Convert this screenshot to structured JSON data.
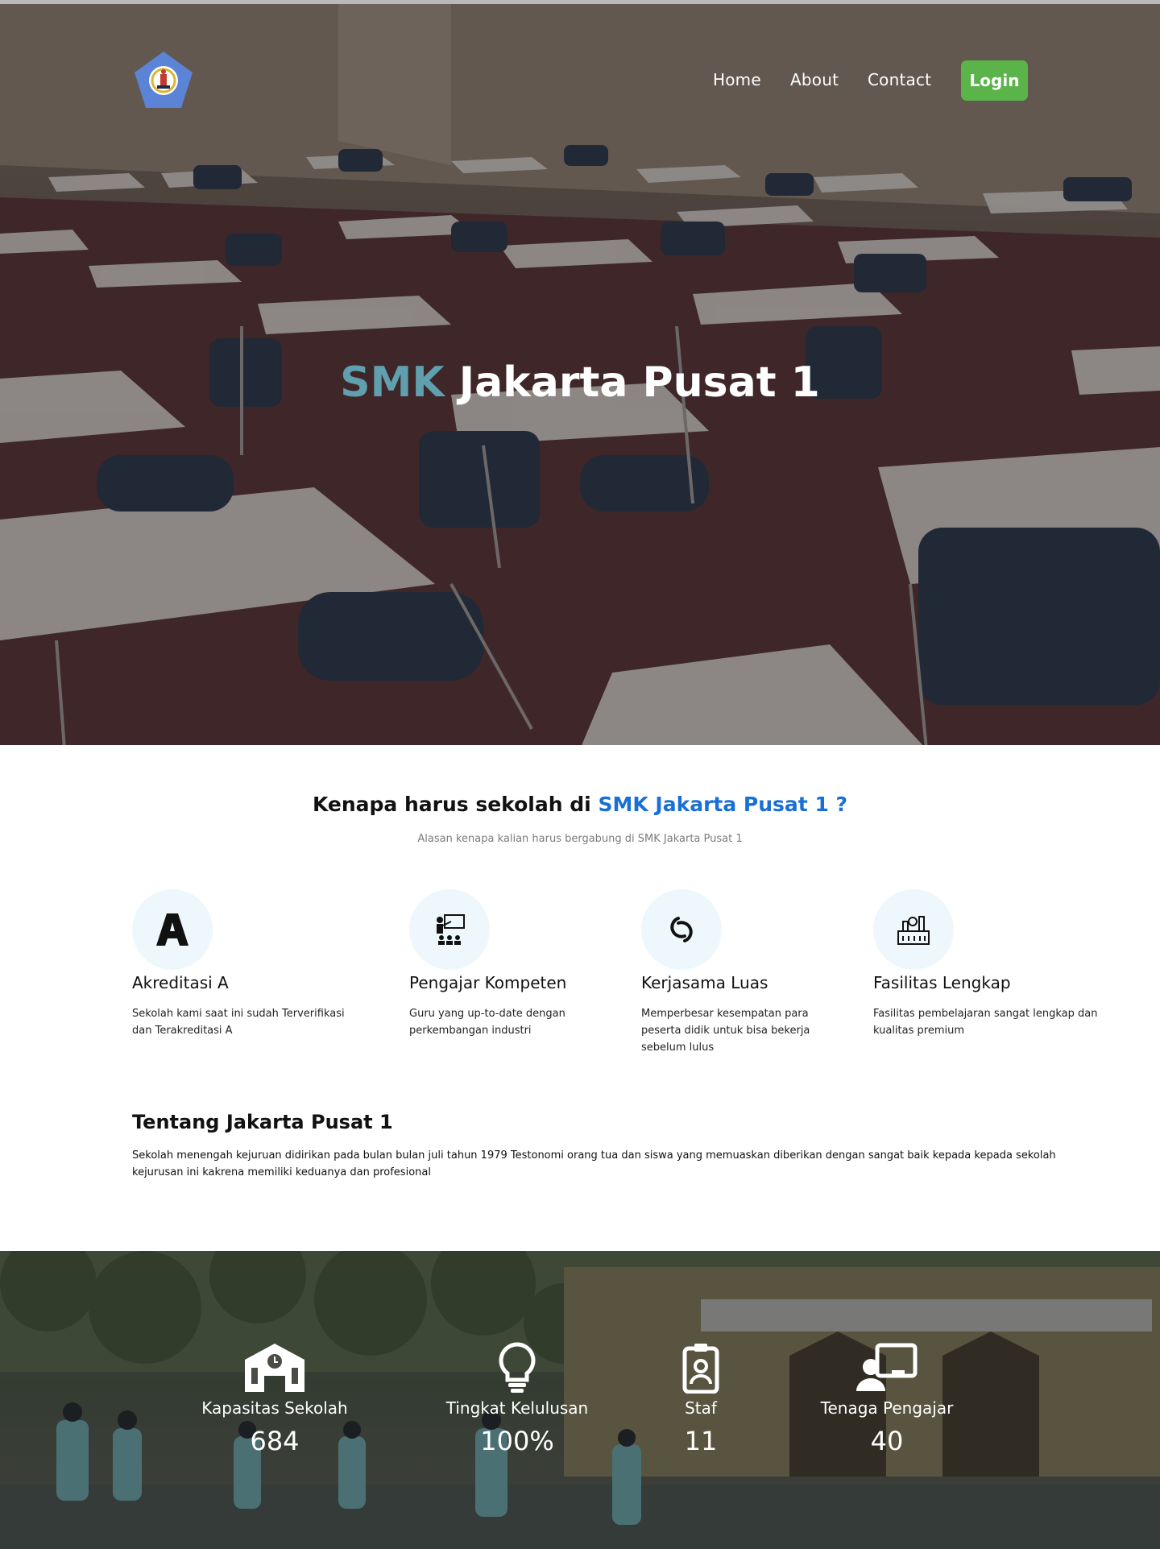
{
  "nav": {
    "home": "Home",
    "about": "About",
    "contact": "Contact",
    "login": "Login"
  },
  "hero": {
    "title_accent": "SMK",
    "title_rest": "Jakarta Pusat 1"
  },
  "why": {
    "title_prefix": "Kenapa harus sekolah di",
    "title_accent": "SMK Jakarta Pusat 1 ?",
    "subtitle": "Alasan kenapa kalian harus bergabung di SMK Jakarta Pusat 1",
    "features": [
      {
        "icon": "letter-a-icon",
        "title": "Akreditasi A",
        "text": "Sekolah kami saat ini sudah Terverifikasi dan Terakreditasi A"
      },
      {
        "icon": "teacher-icon",
        "title": "Pengajar Kompeten",
        "text": "Guru yang up-to-date dengan perkembangan industri"
      },
      {
        "icon": "link-icon",
        "title": "Kerjasama Luas",
        "text": "Memperbesar kesempatan para peserta didik untuk bisa bekerja sebelum lulus"
      },
      {
        "icon": "factory-icon",
        "title": "Fasilitas Lengkap",
        "text": "Fasilitas pembelajaran sangat lengkap dan kualitas premium"
      }
    ]
  },
  "about": {
    "title": "Tentang Jakarta Pusat 1",
    "text": "Sekolah menengah kejuruan didirikan pada bulan bulan juli tahun 1979 Testonomi orang tua dan siswa yang memuaskan diberikan dengan sangat baik kepada kepada sekolah kejurusan ini kakrena memiliki keduanya dan profesional"
  },
  "stats": [
    {
      "icon": "school-icon",
      "label": "Kapasitas Sekolah",
      "value": "684"
    },
    {
      "icon": "lightbulb-icon",
      "label": "Tingkat Kelulusan",
      "value": "100%"
    },
    {
      "icon": "id-badge-icon",
      "label": "Staf",
      "value": "11"
    },
    {
      "icon": "teacher-screen-icon",
      "label": "Tenaga Pengajar",
      "value": "40"
    }
  ],
  "colors": {
    "login_green": "#5bb44a",
    "hero_accent": "#5f9fae",
    "title_accent_blue": "#1a6fd6",
    "icon_circle": "#eef8fc"
  }
}
